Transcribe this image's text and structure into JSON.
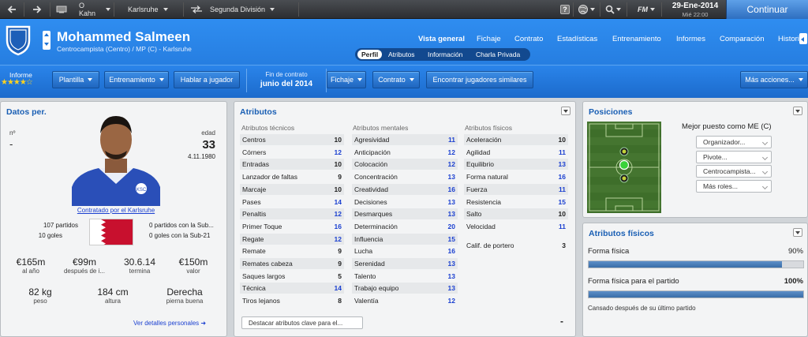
{
  "topbar": {
    "back_icon": "back-arrow-icon",
    "forward_icon": "forward-arrow-icon",
    "home_icon": "home-icon",
    "manager": "O Kahn",
    "club": "Karlsruhe",
    "league": "Segunda División",
    "date": "29-Ene-2014",
    "time": "Mié 22:00",
    "continue_label": "Continuar",
    "fm_label": "FM"
  },
  "player": {
    "name": "Mohammed Salmeen",
    "subtitle": "Centrocampista (Centro) / MP (C) - Karlsruhe"
  },
  "nav": {
    "links": [
      "Vista general",
      "Fichaje",
      "Contrato",
      "Estadísticas",
      "Entrenamiento",
      "Informes",
      "Comparación",
      "Historia"
    ],
    "subtabs": [
      "Perfil",
      "Atributos",
      "Información",
      "Charla Privada"
    ]
  },
  "actions": {
    "informe_label": "Informe",
    "stars": "★★★★☆",
    "plantilla": "Plantilla",
    "entrenamiento": "Entrenamiento",
    "hablar": "Hablar a jugador",
    "fin_contrato_label": "Fin de contrato",
    "fin_contrato_value": "junio del 2014",
    "fichaje": "Fichaje",
    "contrato": "Contrato",
    "encontrar": "Encontrar jugadores similares",
    "mas_acciones": "Más acciones..."
  },
  "datos": {
    "title": "Datos per.",
    "number_label": "nº",
    "number_value": "-",
    "age_label": "edad",
    "age_value": "33",
    "birthdate": "4.11.1980",
    "loan_text": "Contratado por el Karlsruhe",
    "partidos": "107 partidos",
    "goles": "10 goles",
    "partidos_sub": "0 partidos con la Sub...",
    "goles_sub": "0 goles con la Sub-21",
    "flag_colors": {
      "white": "#ffffff",
      "red": "#c8102e"
    },
    "wage_value": "€165m",
    "wage_label": "al año",
    "value2": "€99m",
    "value2_label": "después de i...",
    "expiry_value": "30.6.14",
    "expiry_label": "termina",
    "worth_value": "€150m",
    "worth_label": "valor",
    "weight_value": "82 kg",
    "weight_label": "peso",
    "height_value": "184 cm",
    "height_label": "altura",
    "foot_value": "Derecha",
    "foot_label": "pierna buena",
    "more_link": "Ver detalles personales"
  },
  "atributos": {
    "title": "Atributos",
    "tecnicos_header": "Atributos técnicos",
    "mentales_header": "Atributos mentales",
    "fisicos_header": "Atributos físicos",
    "tecnicos": [
      {
        "name": "Centros",
        "value": "10"
      },
      {
        "name": "Córners",
        "value": "12"
      },
      {
        "name": "Entradas",
        "value": "10"
      },
      {
        "name": "Lanzador de faltas",
        "value": "9"
      },
      {
        "name": "Marcaje",
        "value": "10"
      },
      {
        "name": "Pases",
        "value": "14"
      },
      {
        "name": "Penaltis",
        "value": "12"
      },
      {
        "name": "Primer Toque",
        "value": "16"
      },
      {
        "name": "Regate",
        "value": "12"
      },
      {
        "name": "Remate",
        "value": "9"
      },
      {
        "name": "Remates cabeza",
        "value": "9"
      },
      {
        "name": "Saques largos",
        "value": "5"
      },
      {
        "name": "Técnica",
        "value": "14"
      },
      {
        "name": "Tiros lejanos",
        "value": "8"
      }
    ],
    "mentales": [
      {
        "name": "Agresividad",
        "value": "11"
      },
      {
        "name": "Anticipación",
        "value": "12"
      },
      {
        "name": "Colocación",
        "value": "12"
      },
      {
        "name": "Concentración",
        "value": "13"
      },
      {
        "name": "Creatividad",
        "value": "16"
      },
      {
        "name": "Decisiones",
        "value": "13"
      },
      {
        "name": "Desmarques",
        "value": "13"
      },
      {
        "name": "Determinación",
        "value": "20"
      },
      {
        "name": "Influencia",
        "value": "15"
      },
      {
        "name": "Lucha",
        "value": "16"
      },
      {
        "name": "Serenidad",
        "value": "13"
      },
      {
        "name": "Talento",
        "value": "13"
      },
      {
        "name": "Trabajo equipo",
        "value": "13"
      },
      {
        "name": "Valentía",
        "value": "12"
      }
    ],
    "fisicos": [
      {
        "name": "Aceleración",
        "value": "10"
      },
      {
        "name": "Agilidad",
        "value": "11"
      },
      {
        "name": "Equilibrio",
        "value": "13"
      },
      {
        "name": "Forma natural",
        "value": "16"
      },
      {
        "name": "Fuerza",
        "value": "11"
      },
      {
        "name": "Resistencia",
        "value": "15"
      },
      {
        "name": "Salto",
        "value": "10"
      },
      {
        "name": "Velocidad",
        "value": "11"
      }
    ],
    "portero_label": "Calif. de portero",
    "portero_value": "3",
    "destacar": "Destacar atributos clave para el...",
    "dash": "-"
  },
  "posiciones": {
    "title": "Posiciones",
    "best_label": "Mejor puesto como ME (C)",
    "roles": [
      "Organizador...",
      "Pivote...",
      "Centrocampista...",
      "Más roles..."
    ],
    "pitch_color": "#3e6e2a"
  },
  "fisicos_panel": {
    "title": "Atributos físicos",
    "forma_label": "Forma física",
    "forma_value": "90%",
    "forma_fraction": 0.9,
    "partido_label": "Forma física para el partido",
    "partido_value": "100%",
    "partido_fraction": 1.0,
    "cansado": "Cansado después de su último partido"
  },
  "colors": {
    "accent": "#1f73d6",
    "attr_blue": "#1a3fd0"
  }
}
